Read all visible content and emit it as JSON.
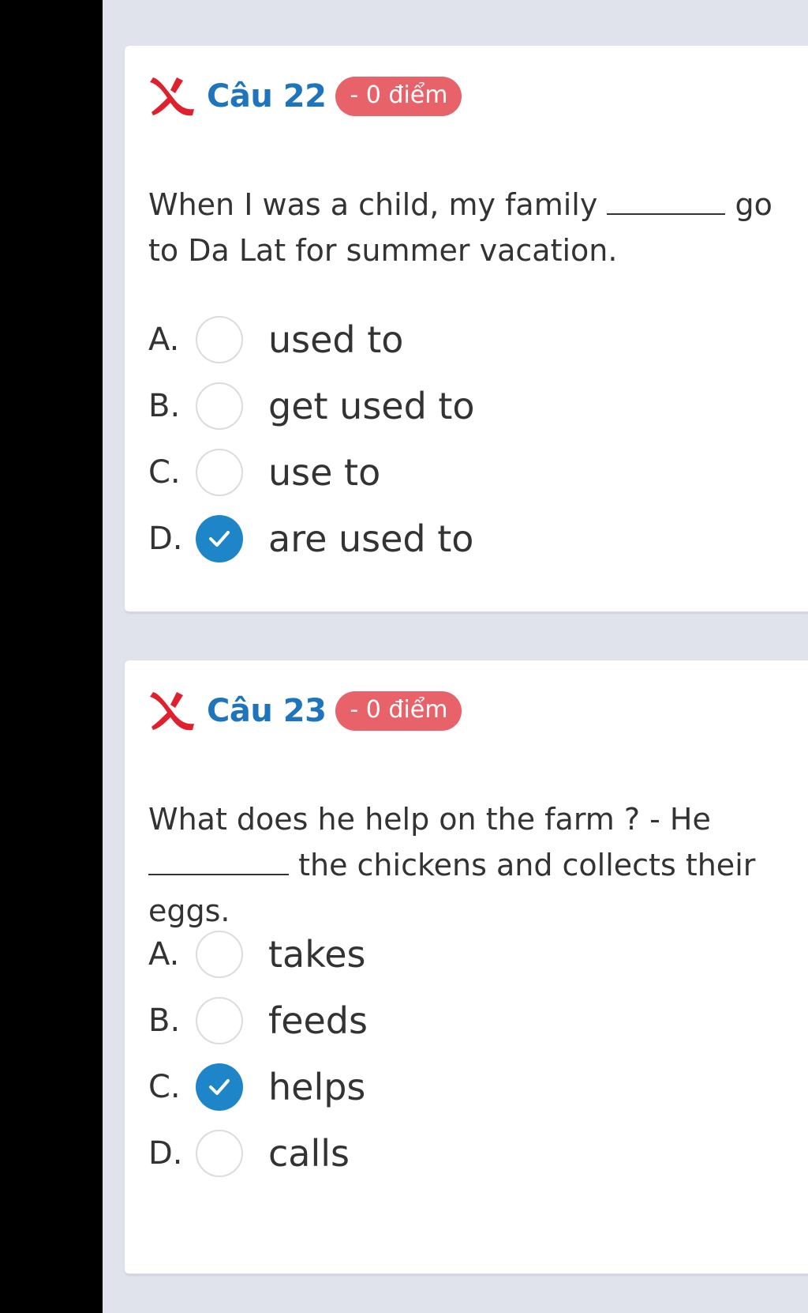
{
  "colors": {
    "title": "#1f74be",
    "badge": "#e8626a",
    "wrong_mark": "#e1202e",
    "checked": "#1e86c8",
    "background": "#e0e3ec"
  },
  "questions": [
    {
      "title": "Câu 22",
      "score": "- 0 điểm",
      "status_icon": "wrong-x-icon",
      "text_before": "When I was a child, my family",
      "text_after": "go to Da Lat for summer vacation.",
      "options": [
        {
          "letter": "A.",
          "text": "used to",
          "selected": false
        },
        {
          "letter": "B.",
          "text": "get used to",
          "selected": false
        },
        {
          "letter": "C.",
          "text": "use to",
          "selected": false
        },
        {
          "letter": "D.",
          "text": "are used to",
          "selected": true
        }
      ]
    },
    {
      "title": "Câu 23",
      "score": "- 0 điểm",
      "status_icon": "wrong-x-icon",
      "text_before": "What does he help on the farm ? - He",
      "text_after": "the chickens and collects their eggs.",
      "options": [
        {
          "letter": "A.",
          "text": "takes",
          "selected": false
        },
        {
          "letter": "B.",
          "text": "feeds",
          "selected": false
        },
        {
          "letter": "C.",
          "text": "helps",
          "selected": true
        },
        {
          "letter": "D.",
          "text": "calls",
          "selected": false
        }
      ]
    }
  ]
}
